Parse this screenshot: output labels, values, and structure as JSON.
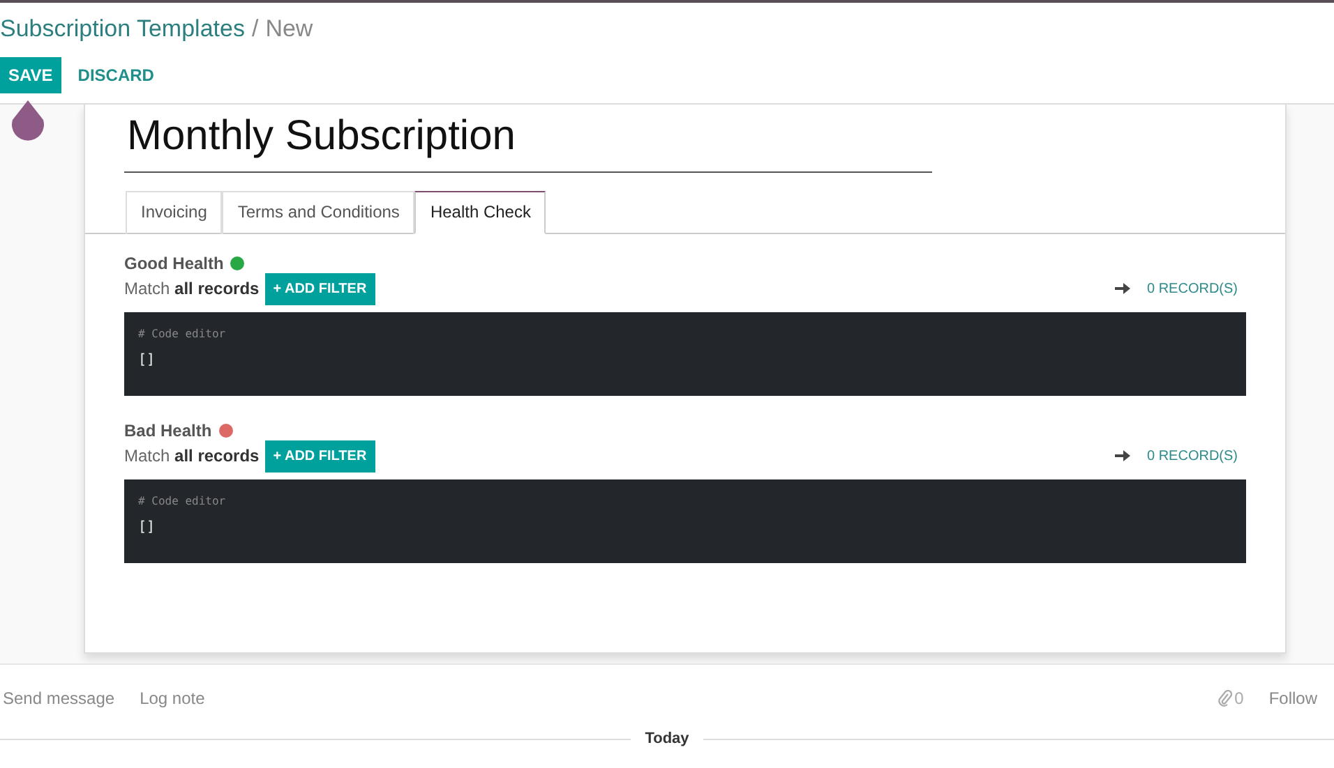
{
  "breadcrumb": {
    "parent": "Subscription Templates",
    "separator": "/",
    "current": "New"
  },
  "buttons": [
    {
      "label": "SAVE",
      "kind": "primary"
    },
    {
      "label": "DISCARD",
      "kind": "link"
    }
  ],
  "title": "Monthly Subscription",
  "tabs": [
    {
      "label": "Invoicing",
      "selected": false
    },
    {
      "label": "Terms and Conditions",
      "selected": false
    },
    {
      "label": "Health Check",
      "selected": true
    }
  ],
  "rules": [
    {
      "name": "Good Health",
      "color": "#28a745",
      "match": "Match **all records**",
      "add_filter": "+ ADD FILTER",
      "records": "0 RECORD(S)",
      "editor_comment": "# Code editor",
      "code": "[]"
    },
    {
      "name": "Bad Health",
      "color": "#dc6965",
      "match": "Match **all records**",
      "add_filter": "+ ADD FILTER",
      "records": "0 RECORD(S)",
      "editor_comment": "# Code editor",
      "code": "[]"
    }
  ],
  "chatter": {
    "actions": [
      "Send message",
      "Log note"
    ],
    "attachments": "0",
    "follow": "Follow",
    "separator": "Today"
  }
}
